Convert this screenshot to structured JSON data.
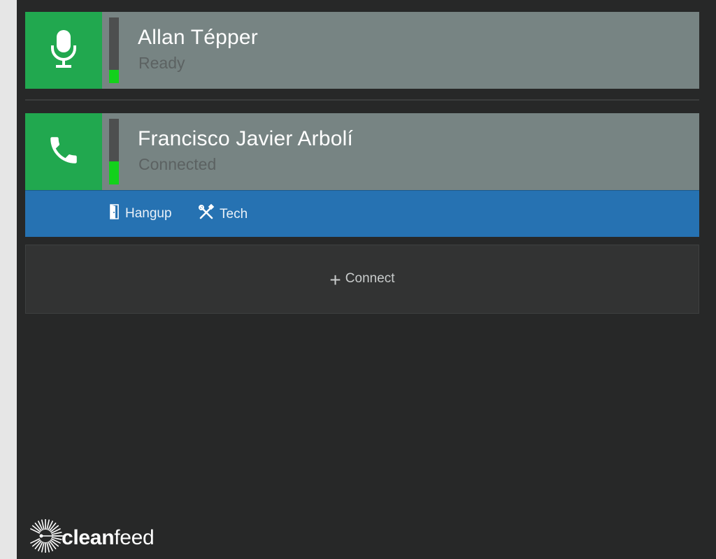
{
  "contacts": [
    {
      "name": "Allan Tépper",
      "status": "Ready",
      "icon": "microphone-icon",
      "level": 0.2
    },
    {
      "name": "Francisco Javier Arbolí",
      "status": "Connected",
      "icon": "phone-icon",
      "level": 0.35
    }
  ],
  "actions": {
    "hangup_label": "Hangup",
    "tech_label": "Tech"
  },
  "connect": {
    "label": "Connect"
  },
  "logo": {
    "bold": "clean",
    "normal": "feed"
  },
  "colors": {
    "accent_green": "#21a84f",
    "action_blue": "#2672b2",
    "meter_green": "#13d11b",
    "card_gray": "#778483",
    "background": "#272828"
  }
}
